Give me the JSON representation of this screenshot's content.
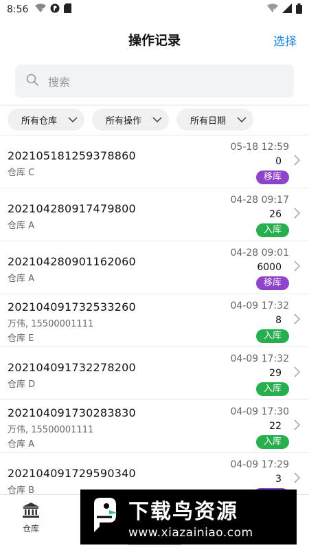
{
  "status_bar": {
    "time": "8:56",
    "left_icons": [
      "wifi-question-icon",
      "circle-p-icon",
      "sd-card-icon"
    ],
    "right_icons": [
      "wifi-x-icon",
      "signal-icon",
      "battery-icon"
    ]
  },
  "header": {
    "title": "操作记录",
    "select_label": "选择"
  },
  "search": {
    "placeholder": "搜索",
    "icon": "search-icon"
  },
  "filters": [
    {
      "label": "所有仓库"
    },
    {
      "label": "所有操作"
    },
    {
      "label": "所有日期"
    }
  ],
  "records": [
    {
      "code": "202105181259378860",
      "line1": "仓库 C",
      "line2": "",
      "time": "05-18 12:59",
      "qty": "0",
      "op": "移库",
      "op_color": "#8e44c9"
    },
    {
      "code": "202104280917479800",
      "line1": "仓库 A",
      "line2": "",
      "time": "04-28 09:17",
      "qty": "26",
      "op": "入库",
      "op_color": "#27ae4f"
    },
    {
      "code": "202104280901162060",
      "line1": "仓库 A",
      "line2": "",
      "time": "04-28 09:01",
      "qty": "6000",
      "op": "移库",
      "op_color": "#8e44c9"
    },
    {
      "code": "202104091732533260",
      "line1": "万伟, 15500001111",
      "line2": "仓库 E",
      "time": "04-09 17:32",
      "qty": "8",
      "op": "入库",
      "op_color": "#27ae4f"
    },
    {
      "code": "202104091732278200",
      "line1": "仓库 D",
      "line2": "",
      "time": "04-09 17:32",
      "qty": "29",
      "op": "入库",
      "op_color": "#27ae4f"
    },
    {
      "code": "202104091730283830",
      "line1": "万伟, 15500001111",
      "line2": "仓库 A",
      "time": "04-09 17:30",
      "qty": "22",
      "op": "入库",
      "op_color": "#27ae4f"
    },
    {
      "code": "202104091729590340",
      "line1": "仓库 B",
      "line2": "",
      "time": "04-09 17:29",
      "qty": "3",
      "op": "",
      "op_color": "#8e44c9"
    }
  ],
  "tabbar": {
    "tabs": [
      {
        "label": "仓库",
        "icon": "bank-icon"
      }
    ]
  },
  "watermark": {
    "title": "下载鸟资源",
    "url": "www.xiazainiao.com",
    "logo_icon": "bird-logo-icon"
  }
}
